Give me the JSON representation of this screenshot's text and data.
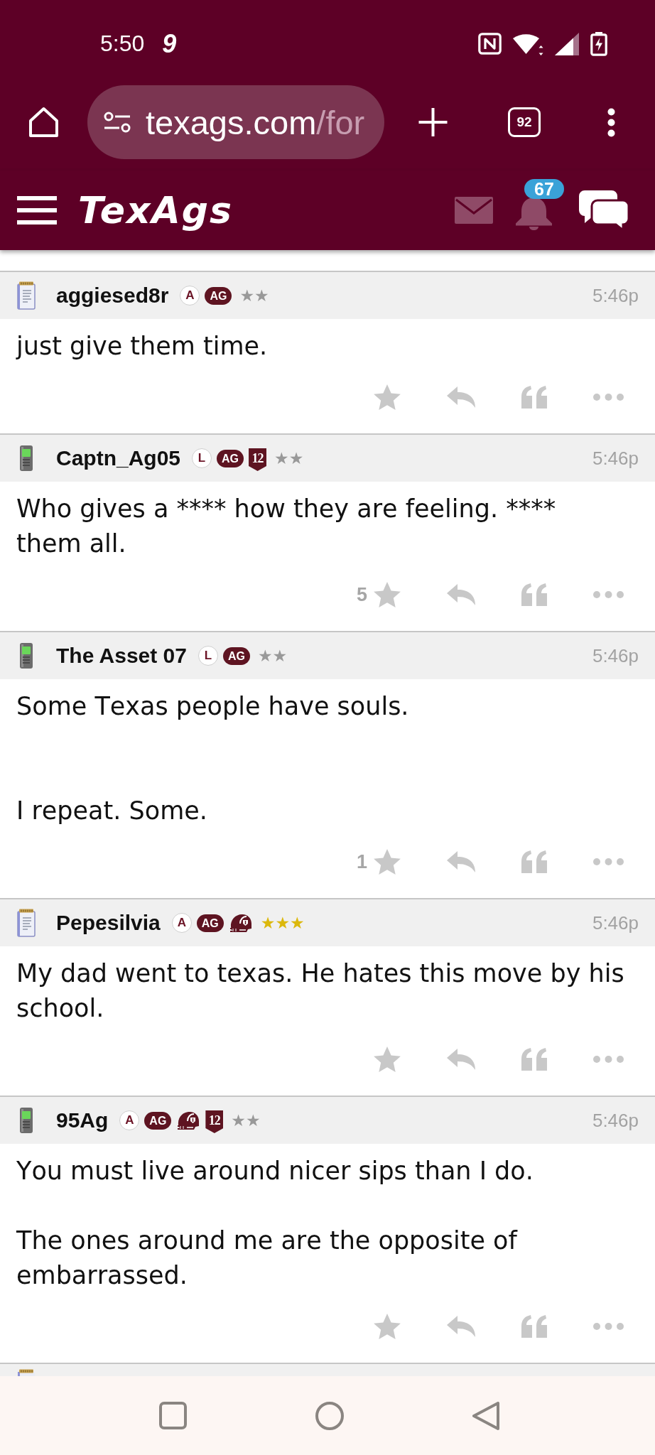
{
  "status_bar": {
    "time": "5:50",
    "notification": "9"
  },
  "browser_toolbar": {
    "address": {
      "host": "texags.com",
      "path": "/for"
    },
    "tab_count": "92"
  },
  "site_header": {
    "logo": "TexAgs",
    "notification_count": "67"
  },
  "posts": [
    {
      "kind": "web",
      "author": "aggiesed8r",
      "badges": [
        {
          "kind": "letter",
          "text": "A"
        },
        {
          "kind": "pill",
          "text": "AG"
        }
      ],
      "rank": {
        "text": "★★",
        "color": "#999999"
      },
      "time": "5:46p",
      "body": "just give them time."
    },
    {
      "kind": "mobile",
      "author": "Captn_Ag05",
      "badges": [
        {
          "kind": "letter",
          "text": "L"
        },
        {
          "kind": "pill",
          "text": "AG"
        },
        {
          "kind": "shield",
          "text": "12"
        }
      ],
      "rank": {
        "text": "★★",
        "color": "#999999"
      },
      "time": "5:46p",
      "body": "Who gives a **** how they are feeling. **** them all.",
      "likes": "5"
    },
    {
      "kind": "mobile",
      "author": "The Asset 07",
      "badges": [
        {
          "kind": "letter",
          "text": "L"
        },
        {
          "kind": "pill",
          "text": "AG"
        }
      ],
      "rank": {
        "text": "★★",
        "color": "#999999"
      },
      "time": "5:46p",
      "body": "Some Texas people have souls.\n\n\nI repeat. Some.",
      "likes": "1"
    },
    {
      "kind": "web",
      "author": "Pepesilvia",
      "badges": [
        {
          "kind": "letter",
          "text": "A"
        },
        {
          "kind": "pill",
          "text": "AG"
        },
        {
          "kind": "helmet"
        }
      ],
      "rank": {
        "text": "★★★",
        "color": "#dcb80c"
      },
      "time": "5:46p",
      "body": "My dad went to texas. He hates this move by his school."
    },
    {
      "kind": "mobile",
      "author": "95Ag",
      "badges": [
        {
          "kind": "letter",
          "text": "A"
        },
        {
          "kind": "pill",
          "text": "AG"
        },
        {
          "kind": "helmet"
        },
        {
          "kind": "shield",
          "text": "12"
        }
      ],
      "rank": {
        "text": "★★",
        "color": "#999999"
      },
      "time": "5:46p",
      "body": "You must live around nicer sips than I do.\n\nThe ones around me are the opposite of embarrassed."
    }
  ],
  "next_post": {
    "kind": "web"
  }
}
